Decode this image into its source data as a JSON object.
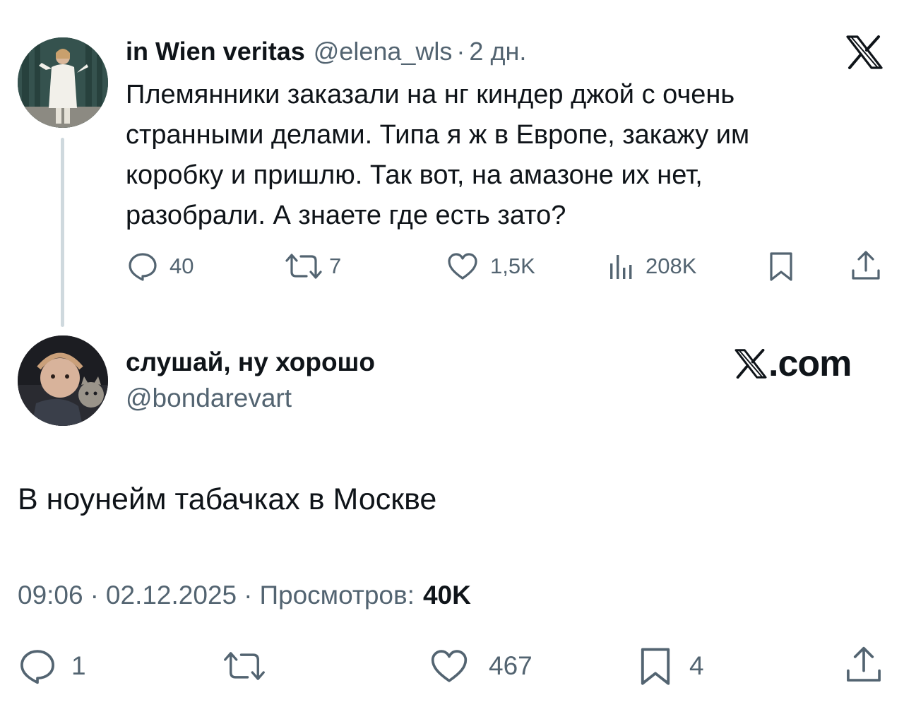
{
  "parent_tweet": {
    "display_name": "in Wien veritas",
    "handle": "@elena_wls",
    "separator": "·",
    "age": "2 дн.",
    "text_lines": [
      "Племянники заказали на нг киндер джой с очень",
      "странными делами. Типа я ж в Европе, закажу им",
      "коробку и пришлю. Так вот, на амазоне их нет,",
      "разобрали. А знаете где есть зато?"
    ],
    "actions": {
      "replies": "40",
      "reposts": "7",
      "likes": "1,5K",
      "views": "208K"
    },
    "icons": [
      "reply-icon",
      "repost-icon",
      "like-icon",
      "views-icon",
      "bookmark-icon",
      "share-icon",
      "x-logo-icon"
    ]
  },
  "reply_tweet": {
    "display_name": "слушай, ну хорошо",
    "handle": "@bondarevart",
    "watermark": ".com",
    "text": "В ноунейм табачках в Москве",
    "meta": {
      "time": "09:06",
      "separator": "·",
      "date": "02.12.2025",
      "views_label": "Просмотров:",
      "views_value": "40K"
    },
    "actions": {
      "replies": "1",
      "reposts": "",
      "likes": "467",
      "bookmarks": "4"
    }
  },
  "colors": {
    "text_primary": "#0f1419",
    "text_secondary": "#536471",
    "thread_line": "#cfd9de",
    "background": "#ffffff"
  }
}
